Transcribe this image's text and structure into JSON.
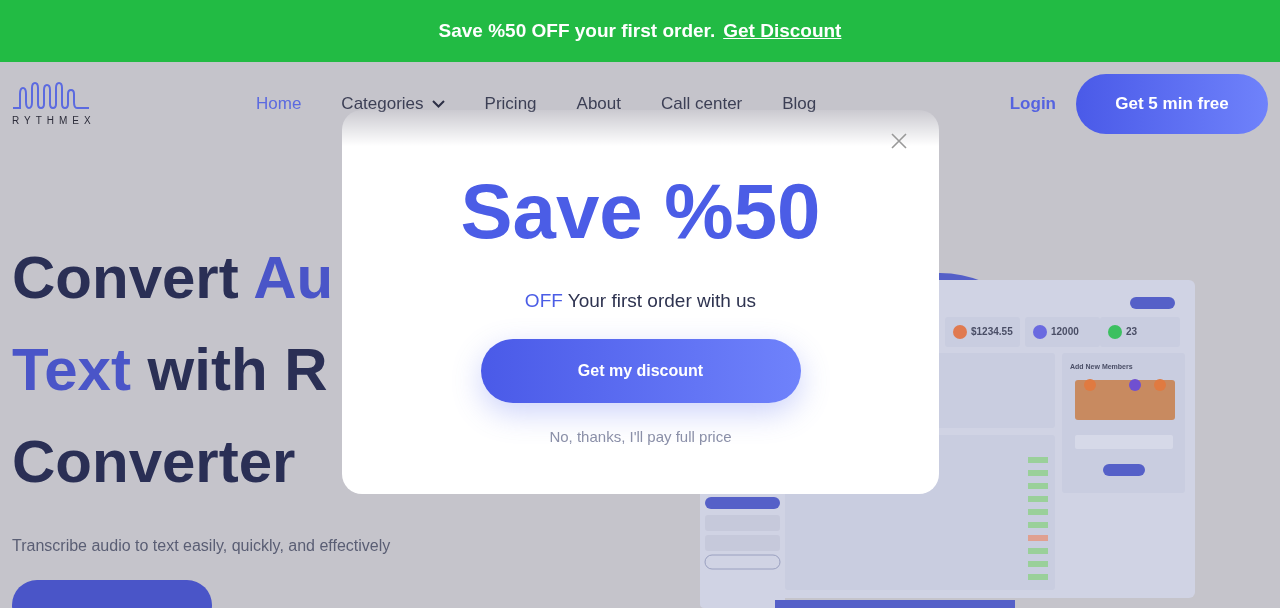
{
  "banner": {
    "text": "Save %50 OFF your first order.",
    "link": "Get Discount"
  },
  "nav": {
    "logo": "RYTHMEX",
    "links": [
      {
        "label": "Home",
        "selected": true,
        "dropdown": false
      },
      {
        "label": "Categories",
        "selected": false,
        "dropdown": true
      },
      {
        "label": "Pricing",
        "selected": false,
        "dropdown": false
      },
      {
        "label": "About",
        "selected": false,
        "dropdown": false
      },
      {
        "label": "Call center",
        "selected": false,
        "dropdown": false
      },
      {
        "label": "Blog",
        "selected": false,
        "dropdown": false
      }
    ],
    "login": "Login",
    "cta": "Get 5 min free"
  },
  "hero": {
    "headline": [
      [
        {
          "text": "Convert ",
          "highlight": false
        },
        {
          "text": "Au",
          "highlight": true
        }
      ],
      [
        {
          "text": "Text",
          "highlight": true
        },
        {
          "text": " with R",
          "highlight": false
        }
      ],
      [
        {
          "text": "Converter",
          "highlight": false
        }
      ]
    ],
    "subtitle": "Transcribe audio to text easily, quickly, and effectively"
  },
  "dashboard": {
    "stats": [
      {
        "value": "$1234.55",
        "color": "#e07a50"
      },
      {
        "value": "12000",
        "color": "#6a6ae0"
      },
      {
        "value": "23",
        "color": "#3cc060"
      }
    ],
    "panel_title": "Add New Members"
  },
  "modal": {
    "title": "Save %50",
    "highlight": "OFF",
    "subtitle": "Your first order with us",
    "button": "Get my discount",
    "decline": "No, thanks, I'll pay full price"
  }
}
